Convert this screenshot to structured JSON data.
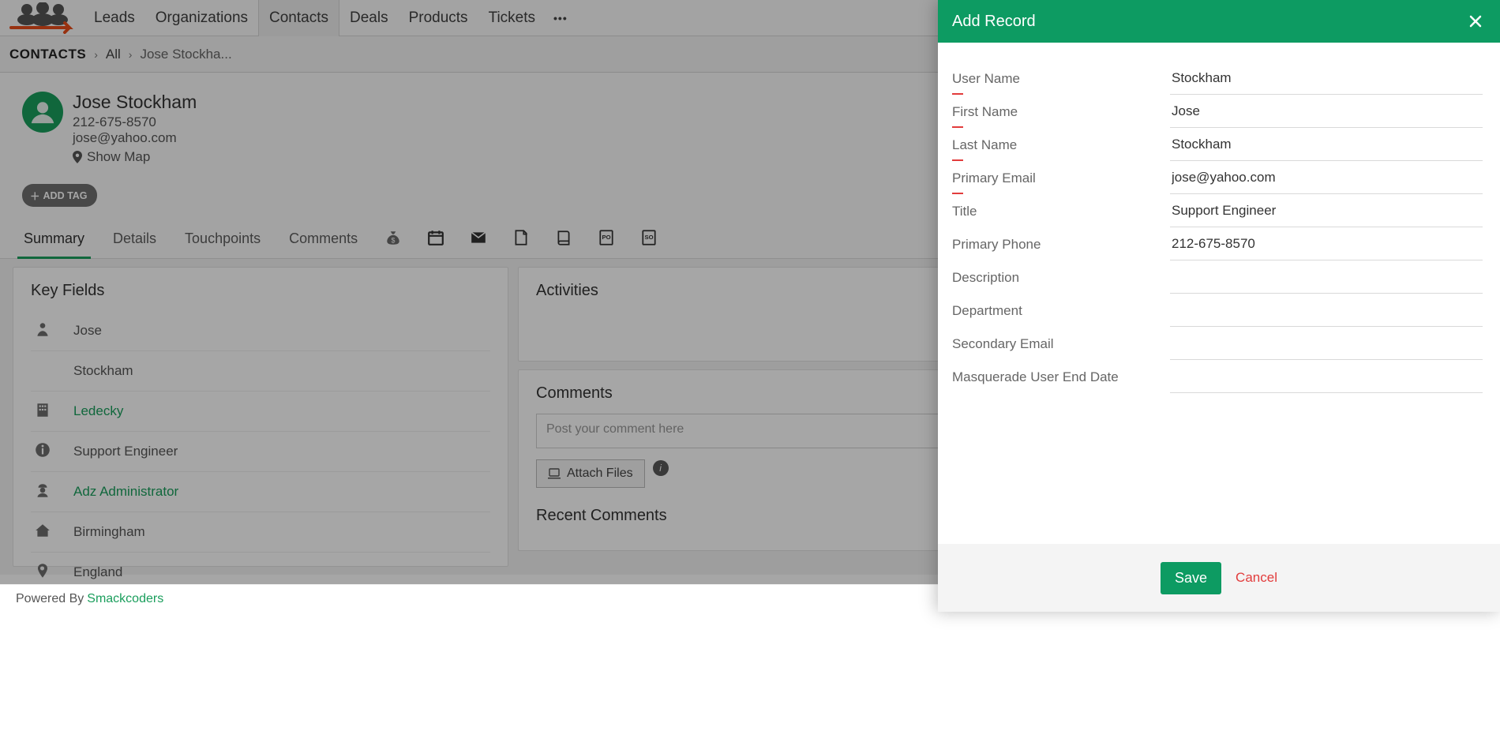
{
  "nav": {
    "items": [
      "Leads",
      "Organizations",
      "Contacts",
      "Deals",
      "Products",
      "Tickets"
    ],
    "active_index": 2
  },
  "breadcrumb": {
    "root": "CONTACTS",
    "all": "All",
    "current": "Jose Stockha..."
  },
  "record": {
    "name": "Jose Stockham",
    "phone": "212-675-8570",
    "email": "jose@yahoo.com",
    "show_map": "Show Map",
    "add_tag": "ADD TAG"
  },
  "tabs": [
    "Summary",
    "Details",
    "Touchpoints",
    "Comments"
  ],
  "key_fields": {
    "heading": "Key Fields",
    "rows": [
      {
        "icon": "person",
        "value": "Jose",
        "link": false
      },
      {
        "icon": "",
        "value": "Stockham",
        "link": false
      },
      {
        "icon": "org",
        "value": "Ledecky",
        "link": true
      },
      {
        "icon": "info",
        "value": "Support Engineer",
        "link": false
      },
      {
        "icon": "agent",
        "value": "Adz Administrator",
        "link": true
      },
      {
        "icon": "home",
        "value": "Birmingham",
        "link": false
      },
      {
        "icon": "pin",
        "value": "England",
        "link": false
      }
    ]
  },
  "activities": {
    "heading": "Activities"
  },
  "comments": {
    "heading": "Comments",
    "placeholder": "Post your comment here",
    "attach": "Attach Files",
    "recent": "Recent Comments"
  },
  "footer": {
    "powered": "Powered By",
    "brand": "Smackcoders"
  },
  "modal": {
    "title": "Add Record",
    "fields": [
      {
        "label": "User Name",
        "value": "Stockham",
        "required": true
      },
      {
        "label": "First Name",
        "value": "Jose",
        "required": true
      },
      {
        "label": "Last Name",
        "value": "Stockham",
        "required": true
      },
      {
        "label": "Primary Email",
        "value": "jose@yahoo.com",
        "required": true
      },
      {
        "label": "Title",
        "value": "Support Engineer",
        "required": false
      },
      {
        "label": "Primary Phone",
        "value": "212-675-8570",
        "required": false
      },
      {
        "label": "Description",
        "value": "",
        "required": false
      },
      {
        "label": "Department",
        "value": "",
        "required": false
      },
      {
        "label": "Secondary Email",
        "value": "",
        "required": false
      },
      {
        "label": "Masquerade User End Date",
        "value": "",
        "required": false
      }
    ],
    "save": "Save",
    "cancel": "Cancel"
  }
}
